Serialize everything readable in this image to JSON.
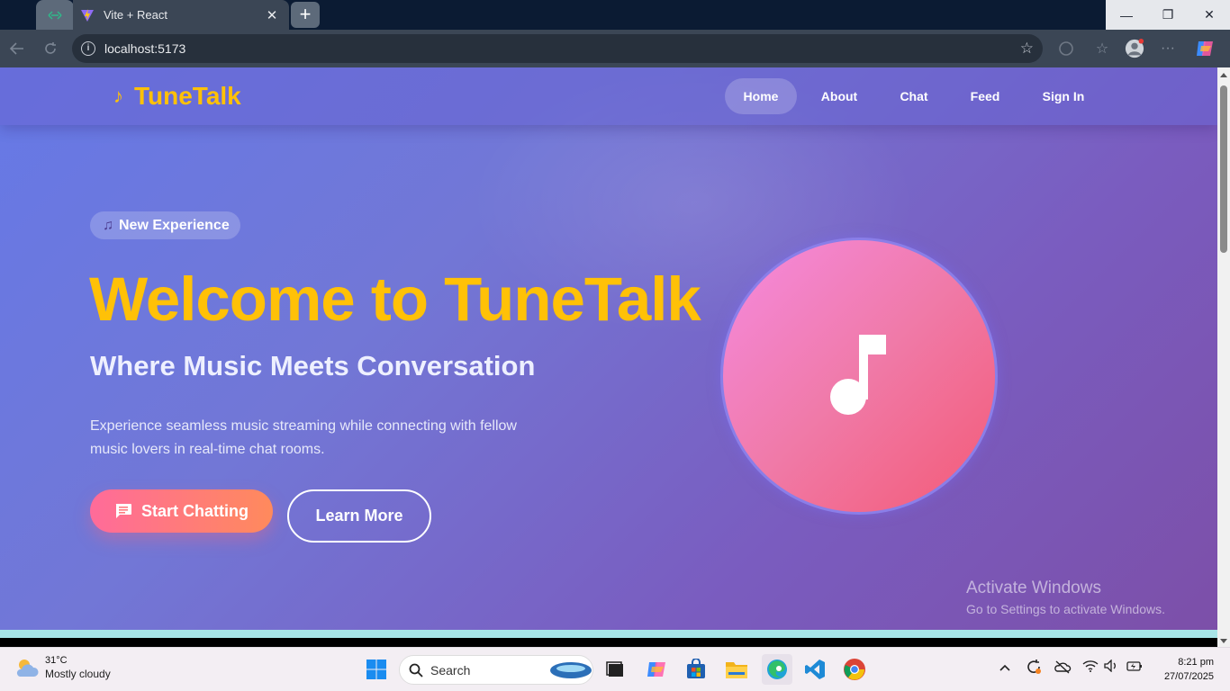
{
  "browser": {
    "tab_title": "Vite + React",
    "tab_close": "✕",
    "new_tab": "+",
    "url": "localhost:5173",
    "window_controls": {
      "minimize": "—",
      "restore": "❐",
      "close": "✕"
    }
  },
  "navbar": {
    "logo_icon": "♪",
    "logo_text": "TuneTalk",
    "links": [
      "Home",
      "About",
      "Chat",
      "Feed",
      "Sign In"
    ],
    "active_link": "Home"
  },
  "hero": {
    "badge_icon": "♫",
    "badge_text": "New Experience",
    "title": "Welcome to TuneTalk",
    "subtitle": "Where Music Meets Conversation",
    "description": "Experience seamless music streaming while connecting with fellow music lovers in real-time chat rooms.",
    "primary_button": "Start Chatting",
    "secondary_button": "Learn More"
  },
  "watermark": {
    "line1": "Activate Windows",
    "line2": "Go to Settings to activate Windows."
  },
  "taskbar": {
    "weather_temp": "31°C",
    "weather_condition": "Mostly cloudy",
    "search_placeholder": "Search",
    "time": "8:21 pm",
    "date": "27/07/2025"
  },
  "colors": {
    "accent_yellow": "#ffc107",
    "page_gradient_start": "#6679e6",
    "page_gradient_end": "#7c4fa8",
    "primary_button_start": "#ff6b9a",
    "primary_button_end": "#ff8a5c",
    "disc_start": "#f58ae0",
    "disc_end": "#f45a76"
  }
}
